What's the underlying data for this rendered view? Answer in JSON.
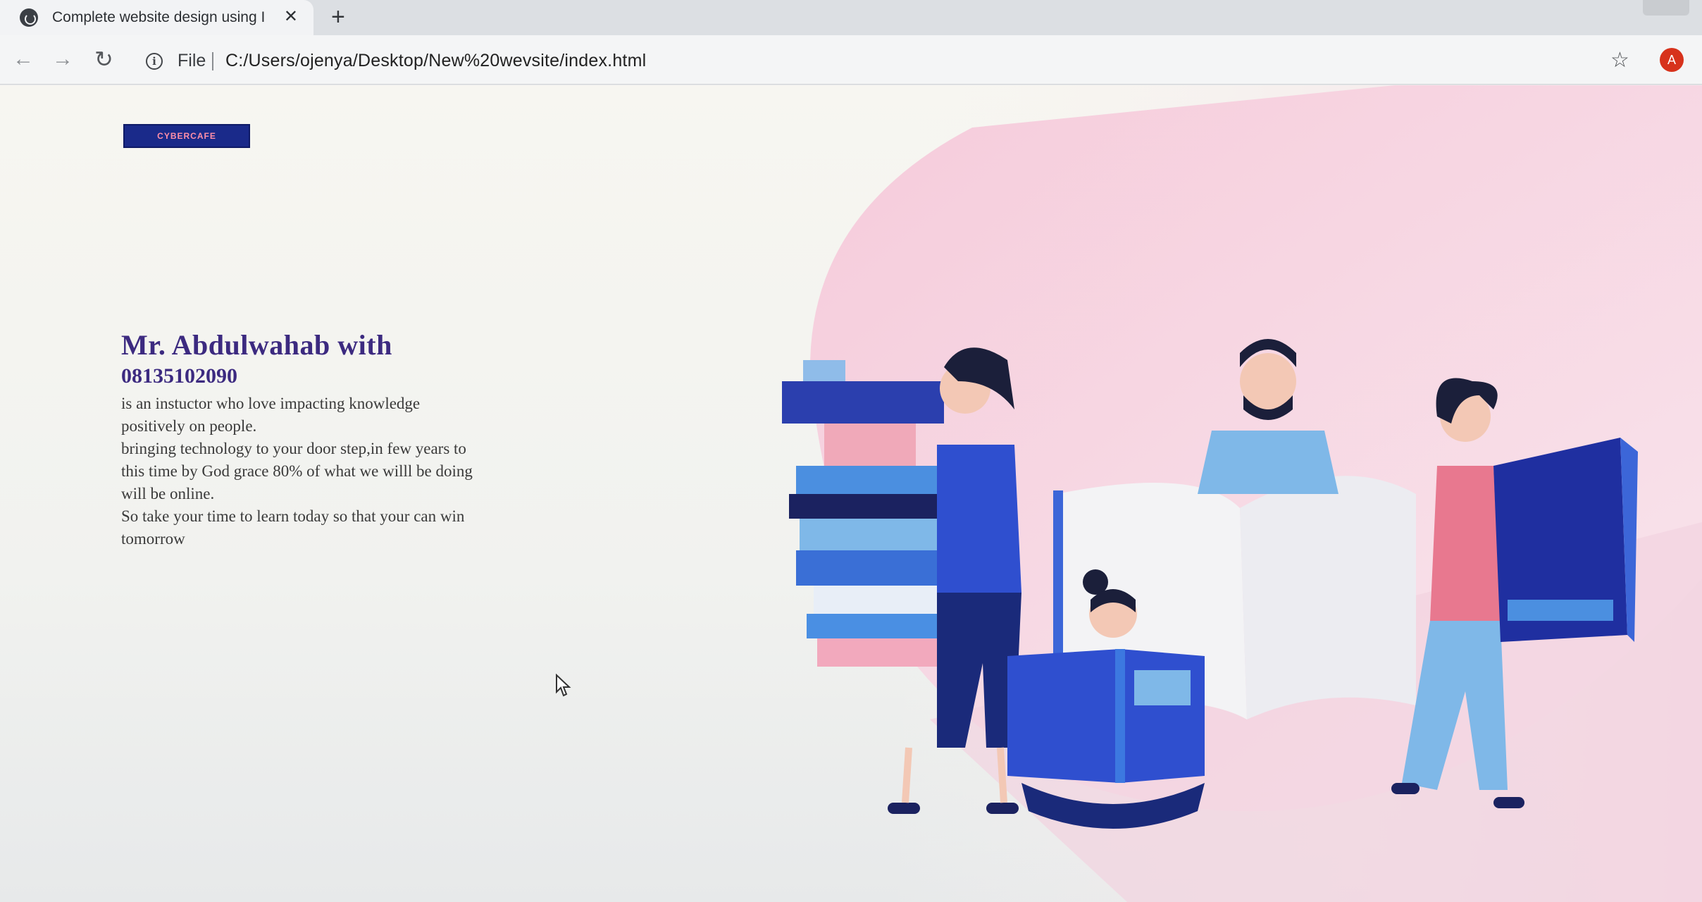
{
  "browser": {
    "tab_title": "Complete website design using I",
    "tab_close": "✕",
    "new_tab": "+",
    "back": "←",
    "forward": "→",
    "reload": "↻",
    "info": "i",
    "file_label": "File",
    "url": "C:/Users/ojenya/Desktop/New%20wevsite/index.html",
    "star": "☆",
    "avatar_letter": "A"
  },
  "page": {
    "logo_text": "CYBERCAFE",
    "title": "Mr. Abdulwahab with",
    "phone": "08135102090",
    "body_lines": [
      "is an instuctor who love impacting knowledge",
      "positively on people.",
      "bringing technology to your door step,in few years to",
      "this time by God grace 80% of what we willl be doing",
      "will be online.",
      "So take your time to learn today so that your can win",
      "tomorrow"
    ]
  },
  "colors": {
    "accent": "#3c2a80",
    "illustration_blue": "#2f4fcf",
    "illustration_pink": "#f3b9cf"
  }
}
